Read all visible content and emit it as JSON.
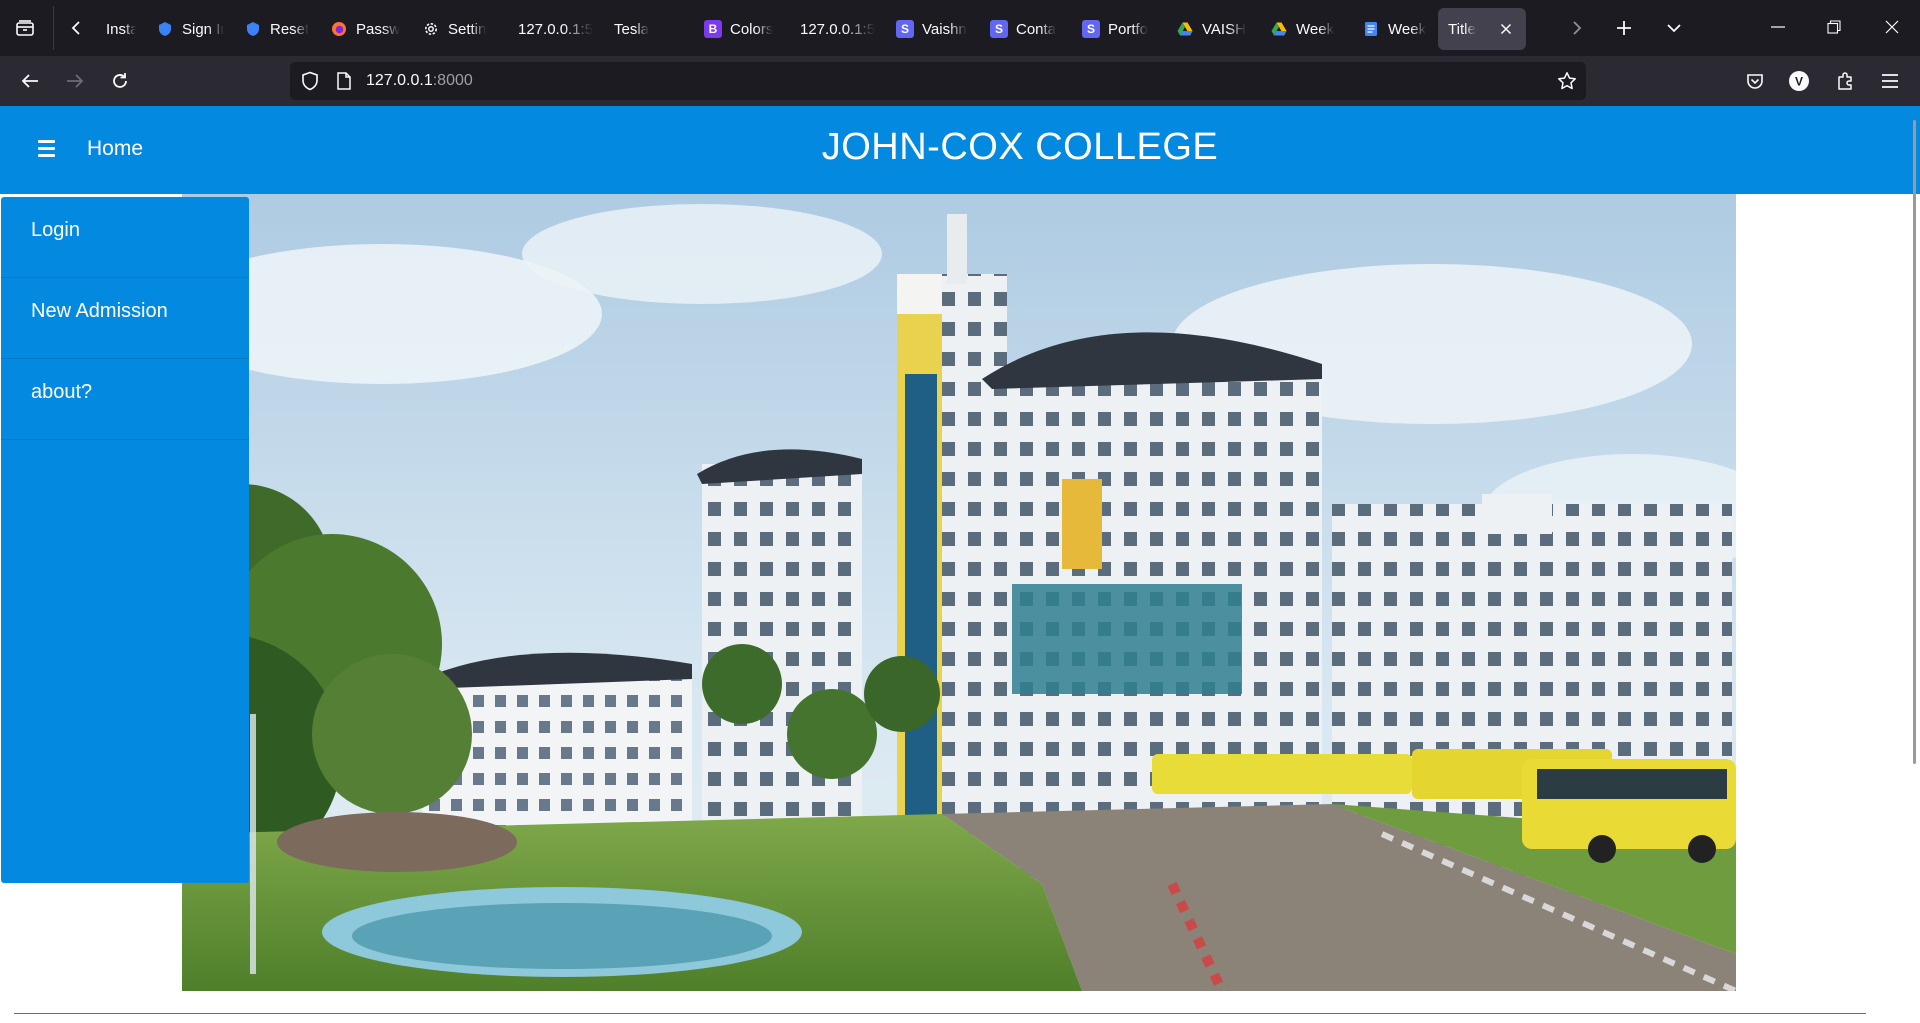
{
  "browser": {
    "tabs": [
      {
        "label": "Installi",
        "favicon": "none",
        "color": ""
      },
      {
        "label": "Sign In",
        "favicon": "shield",
        "color": "#3b82f6"
      },
      {
        "label": "Reset",
        "favicon": "shield",
        "color": "#3b82f6"
      },
      {
        "label": "Passw",
        "favicon": "firefox",
        "color": "#ff7139"
      },
      {
        "label": "Settin",
        "favicon": "gear",
        "color": "#fbfbfe"
      },
      {
        "label": "127.0.0.1:5",
        "favicon": "none",
        "color": ""
      },
      {
        "label": "Tesla",
        "favicon": "none",
        "color": ""
      },
      {
        "label": "Colors",
        "favicon": "letter-b",
        "color": "#7c3aed"
      },
      {
        "label": "127.0.0.1:5",
        "favicon": "none",
        "color": ""
      },
      {
        "label": "Vaishn",
        "favicon": "letter-s",
        "color": "#6366f1"
      },
      {
        "label": "Conta",
        "favicon": "letter-s",
        "color": "#6366f1"
      },
      {
        "label": "Portfo",
        "favicon": "letter-s",
        "color": "#6366f1"
      },
      {
        "label": "VAISH",
        "favicon": "drive",
        "color": "#34a853"
      },
      {
        "label": "Week",
        "favicon": "drive",
        "color": "#34a853"
      },
      {
        "label": "Week",
        "favicon": "docs",
        "color": "#4285f4"
      },
      {
        "label": "Title",
        "favicon": "none",
        "color": "",
        "active": true
      }
    ],
    "url_host": "127.0.0.1",
    "url_port": ":8000"
  },
  "site": {
    "home_label": "Home",
    "title": "JOHN-COX COLLEGE",
    "header_color": "#0489e0"
  },
  "sidebar": {
    "items": [
      {
        "label": "Login"
      },
      {
        "label": "New Admission"
      },
      {
        "label": "about?"
      }
    ]
  },
  "hero": {
    "image_name": "college-campus-photo"
  }
}
